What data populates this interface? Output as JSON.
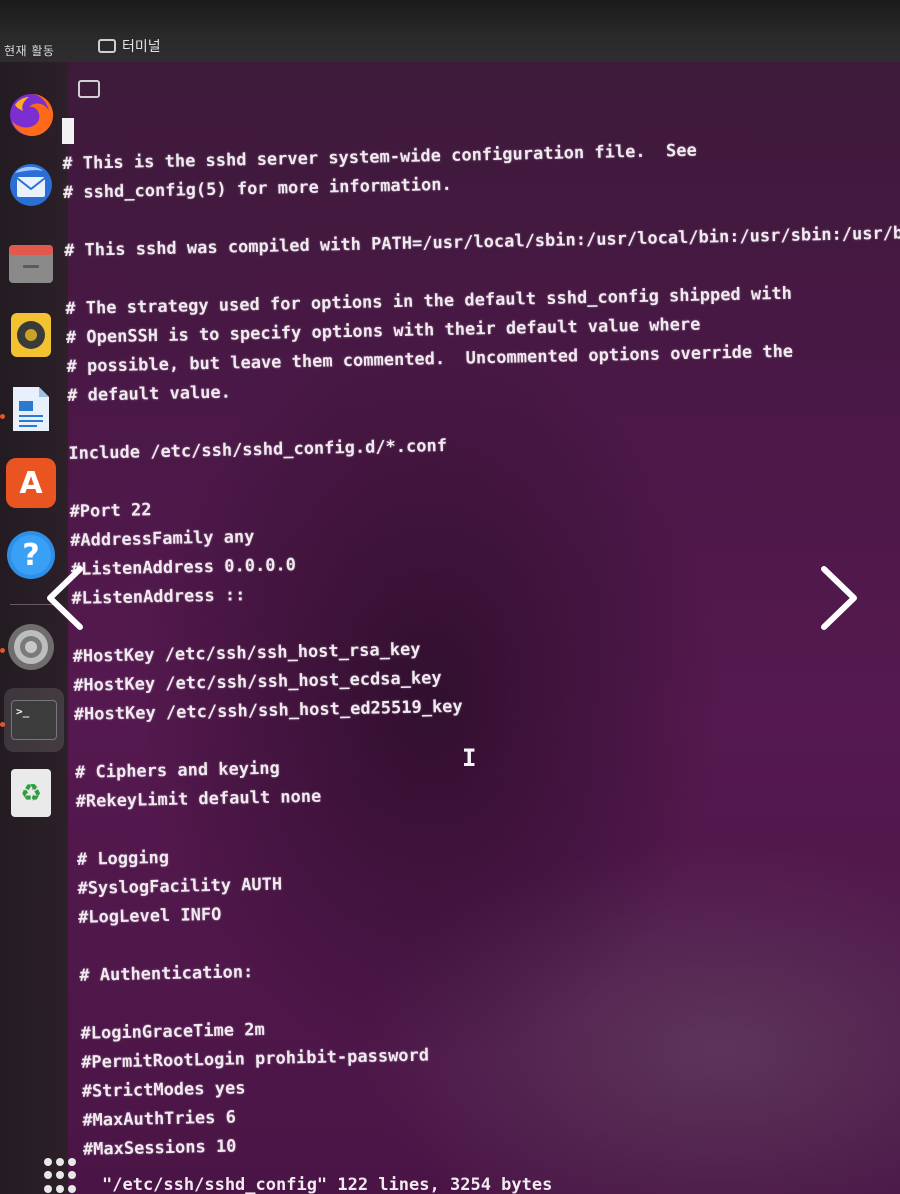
{
  "topbar": {
    "activities_label": "현재 활동",
    "app_label": "터미널"
  },
  "dock": {
    "items": [
      {
        "name": "firefox",
        "icon": "firefox-icon",
        "running": false
      },
      {
        "name": "thunderbird",
        "icon": "mail-icon",
        "running": false
      },
      {
        "name": "files",
        "icon": "folder-icon",
        "running": false
      },
      {
        "name": "rhythmbox",
        "icon": "speaker-icon",
        "running": false
      },
      {
        "name": "libreoffice-writer",
        "icon": "document-icon",
        "running": true
      },
      {
        "name": "app-center",
        "icon": "store-icon",
        "running": false
      },
      {
        "name": "help",
        "icon": "help-icon",
        "running": false
      },
      {
        "name": "settings",
        "icon": "settings-icon",
        "running": true
      },
      {
        "name": "terminal",
        "icon": "terminal-icon",
        "running": true
      },
      {
        "name": "trash",
        "icon": "recycle-icon",
        "running": false
      }
    ],
    "help_glyph": "?",
    "store_glyph": "A",
    "terminal_glyph": ">_",
    "recycle_glyph": "♻"
  },
  "terminal": {
    "lines": [
      "# This is the sshd server system-wide configuration file.  See",
      "# sshd_config(5) for more information.",
      "",
      "# This sshd was compiled with PATH=/usr/local/sbin:/usr/local/bin:/usr/sbin:/usr/bi",
      "",
      "# The strategy used for options in the default sshd_config shipped with",
      "# OpenSSH is to specify options with their default value where",
      "# possible, but leave them commented.  Uncommented options override the",
      "# default value.",
      "",
      "Include /etc/ssh/sshd_config.d/*.conf",
      "",
      "#Port 22",
      "#AddressFamily any",
      "#ListenAddress 0.0.0.0",
      "#ListenAddress ::",
      "",
      "#HostKey /etc/ssh/ssh_host_rsa_key",
      "#HostKey /etc/ssh/ssh_host_ecdsa_key",
      "#HostKey /etc/ssh/ssh_host_ed25519_key",
      "",
      "# Ciphers and keying",
      "#RekeyLimit default none",
      "",
      "# Logging",
      "#SyslogFacility AUTH",
      "#LogLevel INFO",
      "",
      "# Authentication:",
      "",
      "#LoginGraceTime 2m",
      "#PermitRootLogin prohibit-password",
      "#StrictModes yes",
      "#MaxAuthTries 6",
      "#MaxSessions 10"
    ],
    "status": "\"/etc/ssh/sshd_config\" 122 lines, 3254 bytes",
    "ibeam": "I"
  },
  "colors": {
    "terminal_bg": "#55194f",
    "text": "#f1eaf0",
    "running_dot": "#e95420"
  }
}
